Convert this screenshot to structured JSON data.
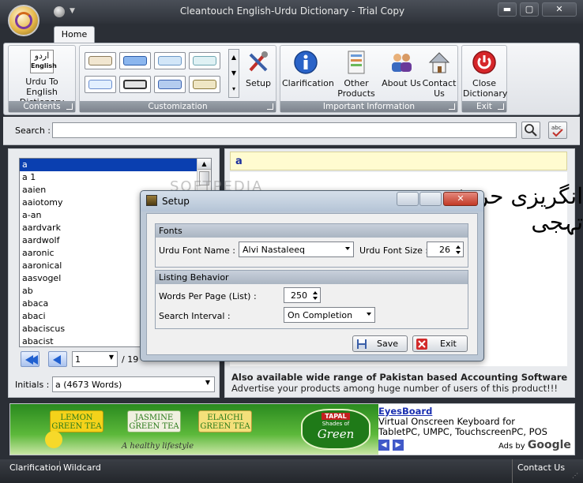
{
  "window": {
    "title": "Cleantouch English-Urdu Dictionary - Trial Copy",
    "controls": {
      "minimize": "▬",
      "maximize": "▢",
      "close": "✕"
    }
  },
  "ribbon": {
    "tab_home": "Home",
    "groups": {
      "contents": {
        "label": "Contents",
        "urdu_to_english": "Urdu To English Dictionary",
        "icon_text_urdu": "اردو",
        "icon_text_en": "English"
      },
      "customization": {
        "label": "Customization",
        "setup": "Setup"
      },
      "info": {
        "label": "Important Information",
        "clarification": "Clarification",
        "other_products": "Other Products ▾",
        "about_us": "About Us",
        "contact_us": "Contact Us"
      },
      "exit": {
        "label": "Exit",
        "close_dictionary": "Close Dictionary"
      }
    }
  },
  "search": {
    "label": "Search :",
    "value": ""
  },
  "word_list": {
    "items": [
      "a",
      "a 1",
      "aaien",
      "aaiotomy",
      "a-an",
      "aardvark",
      "aardwolf",
      "aaronic",
      "aaronical",
      "aasvogel",
      "ab",
      "abaca",
      "abaci",
      "abaciscus",
      "abacist"
    ],
    "selected": "a",
    "page": "1",
    "page_total": "/ 19",
    "initials_label": "Initials :",
    "initials_value": "a (4673 Words)"
  },
  "meaning": {
    "word": "a",
    "urdu": "انگریزی حروف تہجی",
    "watermark": "SOFTPEDIA"
  },
  "ad": {
    "line1": "Also available wide range of Pakistan based Accounting Software",
    "line2": "Advertise your products among huge number of users of this product!!!"
  },
  "banner": {
    "tea": [
      "LEMON GREEN TEA",
      "JASMINE GREEN TEA",
      "ELAICHI GREEN TEA"
    ],
    "tagline": "A healthy lifestyle",
    "tapal_brand": "TAPAL",
    "tapal_sub": "Shades of",
    "tapal_word": "Green",
    "eyes_title": "EyesBoard",
    "eyes_line1": "Virtual Onscreen Keyboard for",
    "eyes_line2": "TabletPC, UMPC, TouchscreenPC, POS",
    "ads_by": "Ads by",
    "google": "Google"
  },
  "status": {
    "clarification": "Clarification",
    "wildcard": "Wildcard",
    "contact_us": "Contact Us"
  },
  "dialog": {
    "title": "Setup",
    "close_glyph": "✕",
    "fonts_section": "Fonts",
    "urdu_font_name_label": "Urdu Font Name :",
    "urdu_font_name_value": "Alvi Nastaleeq",
    "urdu_font_size_label": "Urdu Font Size :",
    "urdu_font_size_value": "26",
    "listing_section": "Listing Behavior",
    "words_per_page_label": "Words Per Page (List) :",
    "words_per_page_value": "250",
    "search_interval_label": "Search Interval :",
    "search_interval_value": "On Completion",
    "save_label": "Save",
    "exit_label": "Exit"
  }
}
